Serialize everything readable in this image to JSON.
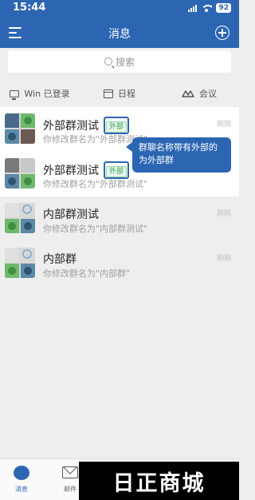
{
  "status_bar": {
    "time": "15:44",
    "battery": "92"
  },
  "header": {
    "title": "消息"
  },
  "search": {
    "placeholder": "搜索"
  },
  "shortcuts": [
    {
      "label": "Win 已登录",
      "icon": "monitor-icon"
    },
    {
      "label": "日程",
      "icon": "calendar-icon"
    },
    {
      "label": "会议",
      "icon": "meeting-icon"
    }
  ],
  "chats": [
    {
      "name": "外部群测试",
      "badge": "外部",
      "preview": "你修改群名为\"外部群测试\"",
      "time": "刚刚"
    },
    {
      "name": "外部群测试",
      "badge": "外部",
      "preview": "你修改群名为\"外部群测试\"",
      "time": "刚刚"
    },
    {
      "name": "内部群测试",
      "preview": "你修改群名为\"内部群测试\"",
      "time": "刚刚"
    },
    {
      "name": "内部群",
      "preview": "你修改群名为\"内部群\"",
      "time": "刚刚"
    }
  ],
  "callout": {
    "text": "群聊名称带有外部的为外部群"
  },
  "tabbar": {
    "messages": "消息",
    "mail": "邮件"
  },
  "watermark": {
    "text": "日正商城"
  },
  "colors": {
    "accent": "#2c66b3",
    "external_badge": "#2e9e4f"
  }
}
